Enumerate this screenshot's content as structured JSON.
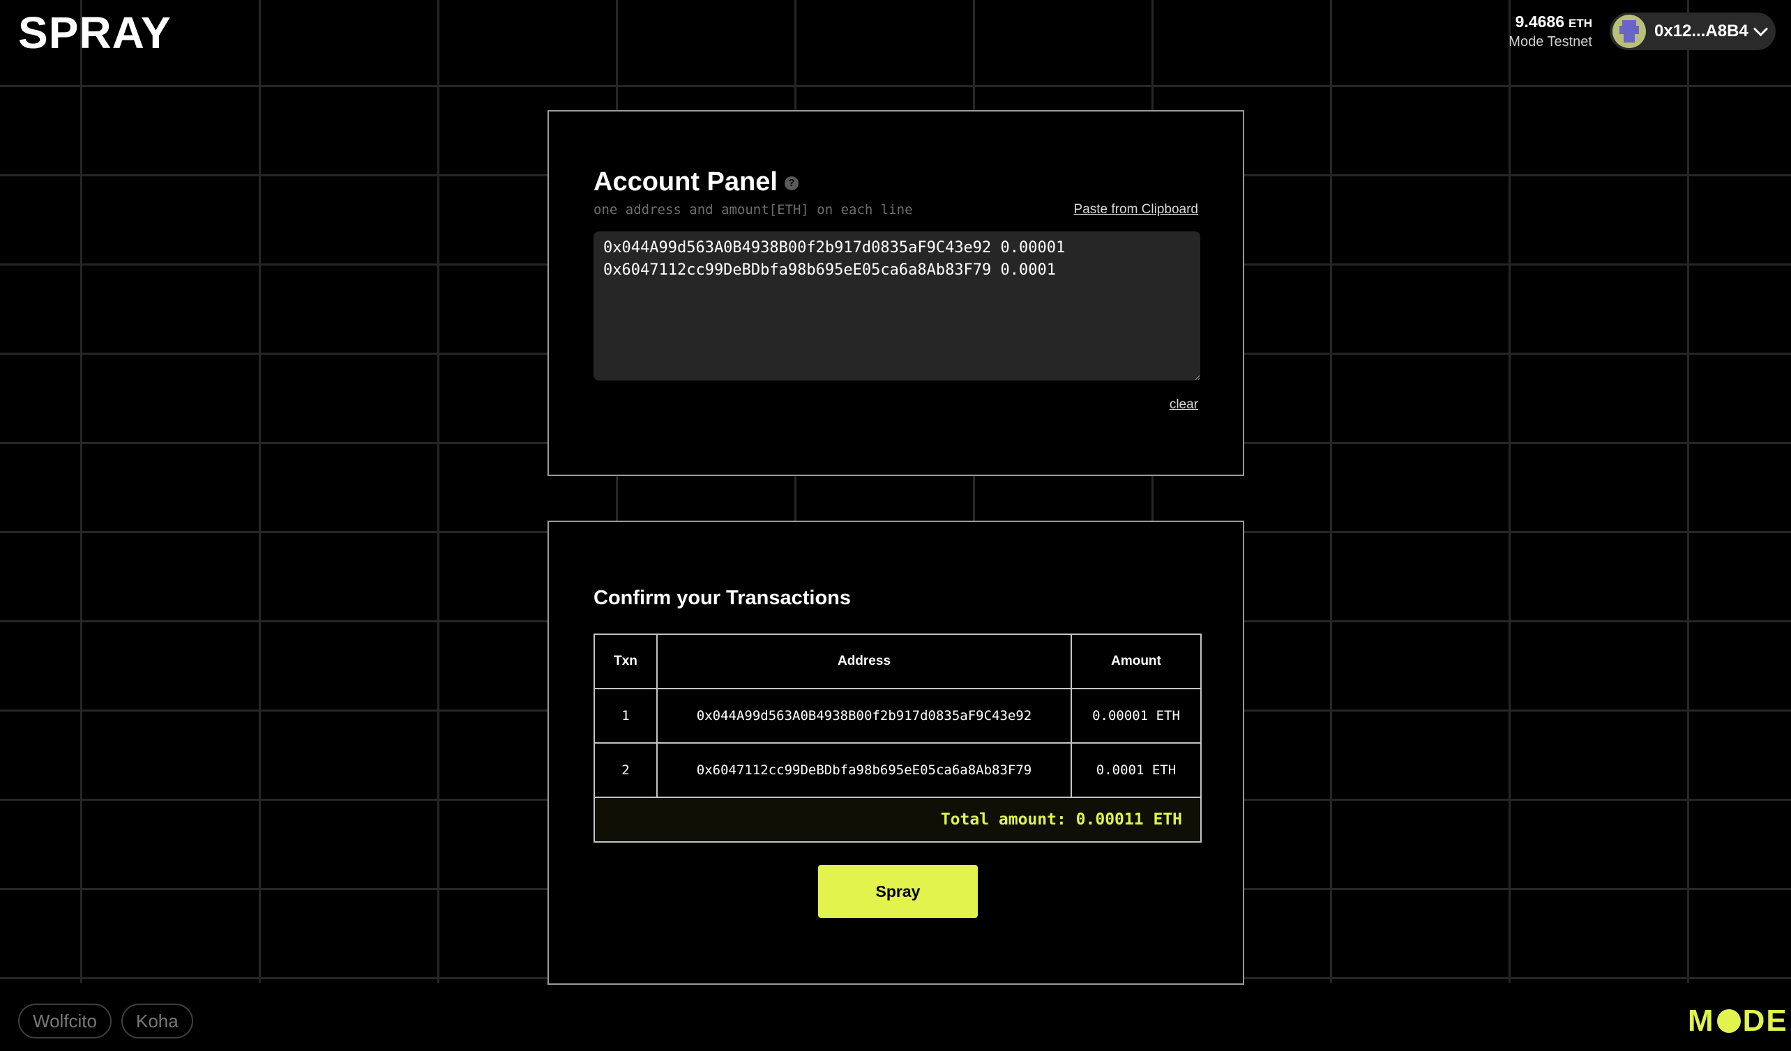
{
  "header": {
    "logo": "SPRAY",
    "balance_value": "9.4686",
    "balance_unit": "ETH",
    "network": "Mode Testnet",
    "wallet_address": "0x12...A8B4"
  },
  "account_panel": {
    "title": "Account Panel",
    "hint": "one address and amount[ETH] on each line",
    "paste_label": "Paste from Clipboard",
    "textarea_value": "0x044A99d563A0B4938B00f2b917d0835aF9C43e92 0.00001\n0x6047112cc99DeBDbfa98b695eE05ca6a8Ab83F79 0.0001",
    "clear_label": "clear"
  },
  "confirm": {
    "title": "Confirm your Transactions",
    "headers": [
      "Txn",
      "Address",
      "Amount"
    ],
    "rows": [
      {
        "txn": "1",
        "address": "0x044A99d563A0B4938B00f2b917d0835aF9C43e92",
        "amount": "0.00001 ETH"
      },
      {
        "txn": "2",
        "address": "0x6047112cc99DeBDbfa98b695eE05ca6a8Ab83F79",
        "amount": "0.0001 ETH"
      }
    ],
    "total": "Total amount: 0.00011 ETH",
    "spray_label": "Spray"
  },
  "footer": {
    "links": [
      "Wolfcito",
      "Koha"
    ],
    "brand_left": "M",
    "brand_right": "DE"
  },
  "colors": {
    "accent": "#e1f34c",
    "background": "#000000",
    "input_bg": "#262626"
  }
}
